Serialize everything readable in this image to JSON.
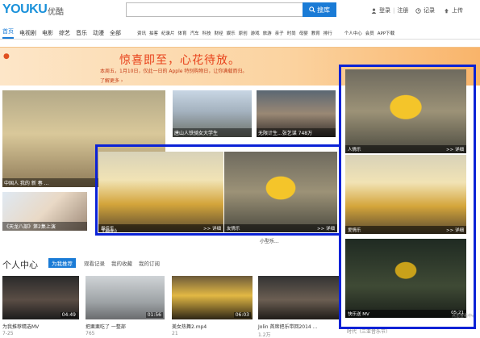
{
  "header": {
    "logo": "YOUKU",
    "logo_cn": "优酷",
    "search_button": "搜库",
    "login": "登录",
    "register": "注册",
    "record": "记录",
    "upload": "上传"
  },
  "nav": {
    "items": [
      "首页",
      "电视剧",
      "电影",
      "综艺",
      "音乐",
      "动漫",
      "全部"
    ],
    "small_items": [
      "资讯",
      "拍客",
      "纪录片",
      "体育",
      "汽车",
      "科技",
      "财经",
      "娱乐",
      "原创",
      "游戏",
      "旅游",
      "亲子",
      "时尚",
      "母婴",
      "教育",
      "排行"
    ],
    "right_items": [
      "个人中心",
      "会员",
      "APP下载"
    ]
  },
  "banner": {
    "title": "惊喜即至，心花待放。",
    "subtitle": "本周五，1月10日，仅此一日的 Apple 特别购物日，让你满载而归。",
    "more": "了解更多 ›"
  },
  "thumbs": {
    "t1_caption": "中国人 我的 新 春 ...",
    "t2_caption": "唐山人铁骑女大学生",
    "t3_caption": "无限计生...张艺谋 748万",
    "t4_caption": "人情乐",
    "t4_tag": ">> 详细",
    "t5_caption": "《天龙八部》第2集上演",
    "t6_caption": "最佳乐",
    "t6_label": "《神曲》",
    "t6_tag": ">> 详细",
    "t7_caption": "友情乐",
    "t7_tag": ">> 详细",
    "t8_caption": "小型乐...",
    "t9_caption": "爱情乐",
    "t9_tag": ">> 详细",
    "t10_caption": "快乐送 MV",
    "t10_time": "05:21",
    "t10_extra": "时代（三亚音乐节）"
  },
  "personal": {
    "title": "个人中心",
    "tabs": [
      "为我推荐",
      "观看记录",
      "我的收藏",
      "我的订阅"
    ],
    "cards": [
      {
        "duration": "04:49",
        "title": "为我推荐精选MV",
        "views": "7-25"
      },
      {
        "duration": "01:56",
        "title": "把栗栗吃了 一整部",
        "views": "765"
      },
      {
        "duration": "06:03",
        "title": "美女热舞2.mp4",
        "views": "21"
      },
      {
        "duration": "",
        "title": "Jolin 首席把乐带回2014 ...",
        "views": "1.2万"
      }
    ]
  },
  "side_labels": {
    "right_bottom": "点击查看中心"
  }
}
